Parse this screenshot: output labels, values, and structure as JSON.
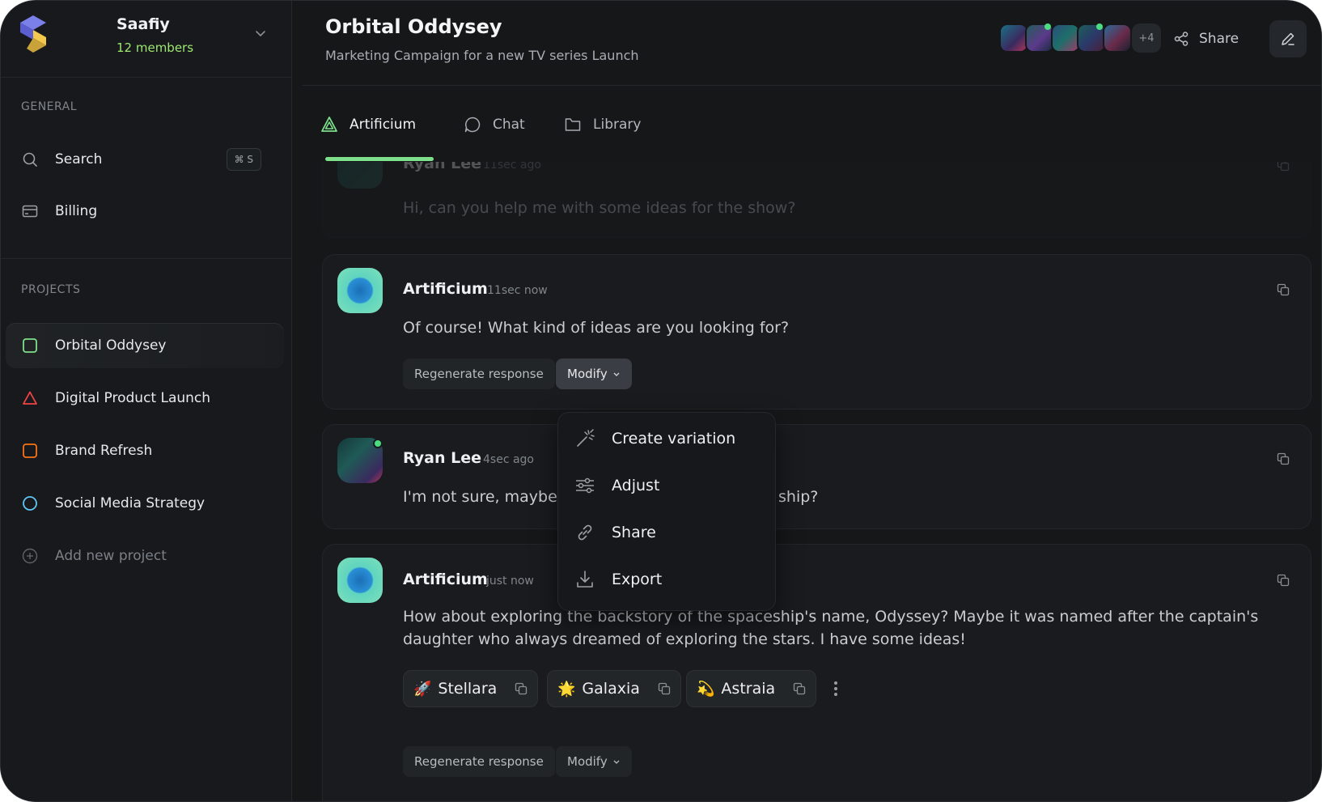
{
  "workspace": {
    "name": "Saafiy",
    "members": "12 members"
  },
  "sidebar": {
    "general_label": "GENERAL",
    "search_label": "Search",
    "search_shortcut": "⌘ S",
    "billing_label": "Billing",
    "projects_label": "PROJECTS",
    "projects": [
      {
        "label": "Orbital Oddysey",
        "color": "#7ee08a",
        "shape": "square"
      },
      {
        "label": "Digital Product Launch",
        "color": "#ef4444",
        "shape": "triangle"
      },
      {
        "label": "Brand Refresh",
        "color": "#f97316",
        "shape": "square"
      },
      {
        "label": "Social Media Strategy",
        "color": "#60c5f5",
        "shape": "circle"
      }
    ],
    "add_project_label": "Add new project"
  },
  "header": {
    "title": "Orbital Oddysey",
    "subtitle": "Marketing Campaign for a new TV series Launch",
    "extra_members": "+4",
    "share_label": "Share"
  },
  "tabs": [
    {
      "label": "Artificium",
      "active": true
    },
    {
      "label": "Chat",
      "active": false
    },
    {
      "label": "Library",
      "active": false
    }
  ],
  "messages": [
    {
      "author": "Ryan Lee",
      "time": "11sec ago",
      "text": "Hi, can you help me with some ideas for the show?"
    },
    {
      "author": "Artificium",
      "time": "11sec now",
      "text": "Of course! What kind of ideas are you looking for?",
      "regenerate": "Regenerate response",
      "modify": "Modify"
    },
    {
      "author": "Ryan Lee",
      "time": "4sec ago",
      "text_left": "I'm not sure, maybe s",
      "text_right": "ship?"
    },
    {
      "author": "Artificium",
      "time": "just now",
      "text": "How about exploring the backstory of the spaceship's name, Odyssey? Maybe it was named after the captain's daughter who always dreamed of exploring the stars. I have some ideas!",
      "regenerate": "Regenerate response",
      "modify": "Modify",
      "suggestions": [
        {
          "emoji": "🚀",
          "label": "Stellara"
        },
        {
          "emoji": "🌟",
          "label": "Galaxia"
        },
        {
          "emoji": "💫",
          "label": "Astraia"
        }
      ]
    }
  ],
  "modify_menu": {
    "items": [
      {
        "label": "Create variation",
        "icon": "magic-wand-icon"
      },
      {
        "label": "Adjust",
        "icon": "sliders-icon"
      },
      {
        "label": "Share",
        "icon": "link-icon"
      },
      {
        "label": "Export",
        "icon": "download-icon"
      }
    ]
  },
  "colors": {
    "accent": "#7ee08a",
    "background": "#151719",
    "online": "#4ade80"
  }
}
